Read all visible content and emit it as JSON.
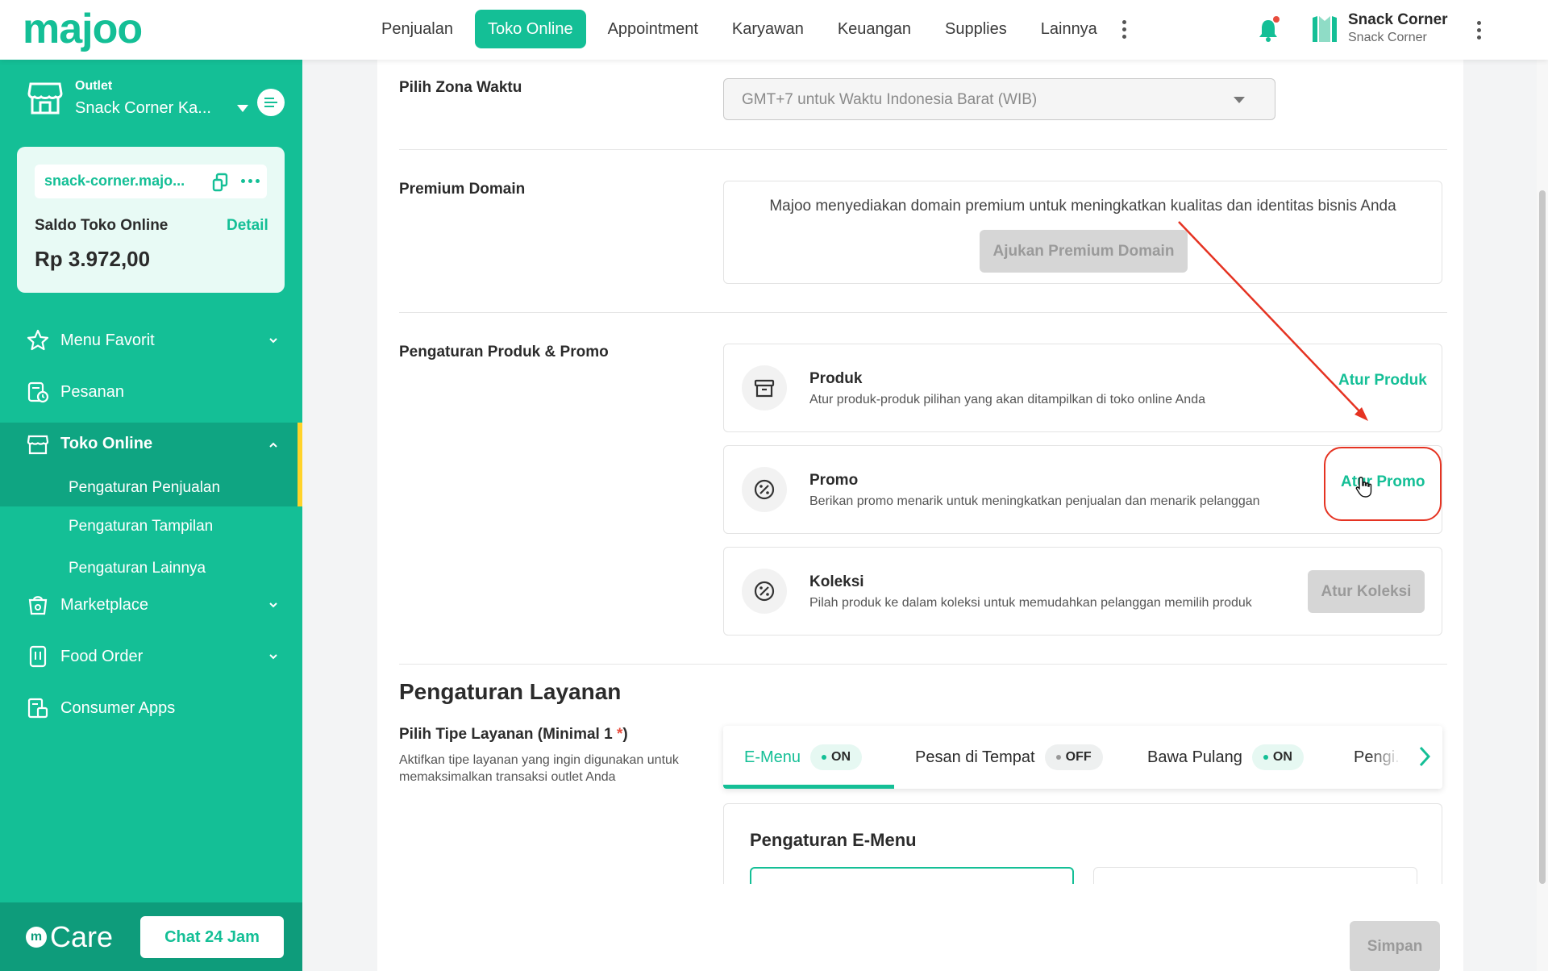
{
  "brand": {
    "logo_text": "majoo",
    "color": "#14bf96"
  },
  "topnav": {
    "items": [
      {
        "label": "Penjualan",
        "active": false
      },
      {
        "label": "Toko Online",
        "active": true
      },
      {
        "label": "Appointment",
        "active": false
      },
      {
        "label": "Karyawan",
        "active": false
      },
      {
        "label": "Keuangan",
        "active": false
      },
      {
        "label": "Supplies",
        "active": false
      },
      {
        "label": "Lainnya",
        "active": false
      }
    ],
    "more_icon": "kebab-icon",
    "notification_icon": "bell-icon"
  },
  "user": {
    "name": "Snack Corner",
    "subtitle": "Snack Corner"
  },
  "sidebar": {
    "outlet_label": "Outlet",
    "outlet_name": "Snack Corner Ka...",
    "store_url": "snack-corner.majo...",
    "saldo_label": "Saldo Toko Online",
    "saldo_detail": "Detail",
    "saldo_value": "Rp 3.972,00",
    "items": [
      {
        "label": "Menu Favorit",
        "icon": "star-icon",
        "chevron": "down"
      },
      {
        "label": "Pesanan",
        "icon": "order-icon",
        "chevron": ""
      },
      {
        "label": "Toko Online",
        "icon": "store-icon",
        "chevron": "up"
      },
      {
        "label": "Marketplace",
        "icon": "marketplace-icon",
        "chevron": "down"
      },
      {
        "label": "Food Order",
        "icon": "food-order-icon",
        "chevron": "down"
      },
      {
        "label": "Consumer Apps",
        "icon": "consumer-apps-icon",
        "chevron": ""
      }
    ],
    "subitems": [
      {
        "label": "Pengaturan Penjualan",
        "current": true
      },
      {
        "label": "Pengaturan Tampilan",
        "current": false
      },
      {
        "label": "Pengaturan Lainnya",
        "current": false
      }
    ],
    "care_label": "Care",
    "chat_button": "Chat 24 Jam"
  },
  "main": {
    "timezone": {
      "label": "Pilih Zona Waktu",
      "value": "GMT+7 untuk Waktu Indonesia Barat (WIB)"
    },
    "premium_domain": {
      "label": "Premium Domain",
      "description": "Majoo menyediakan domain premium untuk meningkatkan kualitas dan identitas bisnis Anda",
      "button": "Ajukan Premium Domain"
    },
    "product_promo": {
      "label": "Pengaturan Produk & Promo",
      "items": [
        {
          "title": "Produk",
          "desc": "Atur produk-produk pilihan yang akan ditampilkan di toko online Anda",
          "action": "Atur Produk",
          "icon": "archive-box-icon"
        },
        {
          "title": "Promo",
          "desc": "Berikan promo menarik untuk meningkatkan penjualan dan menarik pelanggan",
          "action": "Atur Promo",
          "icon": "percent-badge-icon"
        },
        {
          "title": "Koleksi",
          "desc": "Pilah produk ke dalam koleksi untuk memudahkan pelanggan memilih produk",
          "action": "Atur Koleksi",
          "icon": "percent-badge-icon"
        }
      ]
    },
    "layanan": {
      "section_title": "Pengaturan Layanan",
      "type_label": "Pilih Tipe Layanan (Minimal 1",
      "type_label_required": "*",
      "type_label_close": ")",
      "type_desc": "Aktifkan tipe layanan yang ingin digunakan untuk memaksimalkan transaksi outlet Anda",
      "tabs": [
        {
          "label": "E-Menu",
          "status": "ON",
          "active": true
        },
        {
          "label": "Pesan di Tempat",
          "status": "OFF",
          "active": false
        },
        {
          "label": "Bawa Pulang",
          "status": "ON",
          "active": false
        },
        {
          "label": "Pengi...",
          "status": "",
          "active": false
        }
      ],
      "emenu_title": "Pengaturan E-Menu"
    },
    "save_button": "Simpan"
  }
}
